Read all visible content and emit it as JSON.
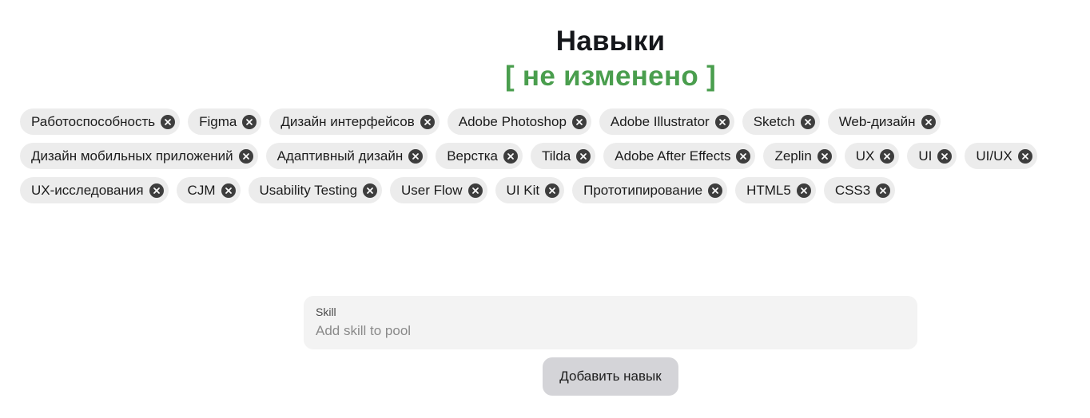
{
  "header": {
    "title": "Навыки",
    "status": "[ не изменено ]",
    "status_color": "#4a9e4e"
  },
  "skills": {
    "rows": [
      [
        "Работоспособность",
        "Figma",
        "Дизайн интерфейсов",
        "Adobe Photoshop",
        "Adobe Illustrator",
        "Sketch",
        "Web-дизайн"
      ],
      [
        "Дизайн мобильных приложений",
        "Адаптивный дизайн",
        "Верстка",
        "Tilda",
        "Adobe After Effects",
        "Zeplin",
        "UX",
        "UI",
        "UI/UX"
      ],
      [
        "UX-исследования",
        "CJM",
        "Usability Testing",
        "User Flow",
        "UI Kit",
        "Прототипирование",
        "HTML5",
        "CSS3"
      ]
    ],
    "remove_icon": "close-circle-icon"
  },
  "form": {
    "field_label": "Skill",
    "placeholder": "Add skill to pool",
    "value": "",
    "add_button_label": "Добавить навык"
  }
}
